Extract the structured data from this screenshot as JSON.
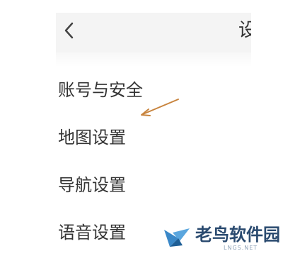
{
  "colors": {
    "header_background": "#f4f4f4",
    "text": "#333333",
    "arrow_annotation": "#c8843e",
    "watermark_text": "#2a4a6f",
    "watermark_logo": "#3a88c8"
  },
  "header": {
    "back_icon": "chevron-left-icon",
    "title": "设置"
  },
  "settings": {
    "items": [
      {
        "label": "账号与安全"
      },
      {
        "label": "地图设置"
      },
      {
        "label": "导航设置"
      },
      {
        "label": "语音设置"
      }
    ]
  },
  "watermark": {
    "logo_icon": "bird-logo-icon",
    "text": "老鸟软件园",
    "subtext": "LNGS.NET"
  }
}
